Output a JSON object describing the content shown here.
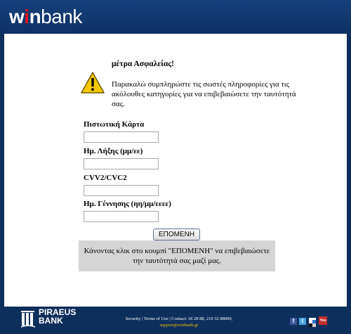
{
  "header": {
    "logo_w": "w",
    "logo_i": "i",
    "logo_n": "n",
    "logo_bank": "bank"
  },
  "notice": {
    "title": "μέτρα Ασφαλείας!",
    "intro": "Παρακαλώ συμπληρώστε τις σωστές πληροφορίες για τις ακόλουθες κατηγορίες για να επιβεβαιώσετε την ταυτότητά σας."
  },
  "form": {
    "fields": [
      {
        "label": "Πιστωτική Κάρτα",
        "value": ""
      },
      {
        "label": "Ημ. Λήξης (μμ/εε)",
        "value": ""
      },
      {
        "label": "CVV2/CVC2",
        "value": ""
      },
      {
        "label": "Ημ. Γέννησης (ηη/μμ/εεεε)",
        "value": ""
      }
    ],
    "next_label": "ΕΠΟΜΕΝΗ"
  },
  "note": "Κάνοντας κλικ στο κουμπί \"ΕΠΟΜΕΝΗ\" να επιβεβαιώσετε την ταυτότητά σας μαζί μας.",
  "footer": {
    "bank_line1": "PIRAEUS",
    "bank_line2": "BANK",
    "security": "Security",
    "terms": "Terms of Use",
    "contact": "Contact: 18 28 88, 210 32 88000,",
    "email": "support@winbank.gr",
    "separator": " | ",
    "social": [
      "f",
      "t",
      "",
      "You"
    ]
  },
  "colors": {
    "page_background": "#0d2f5c",
    "logo_accent": "#e8141b",
    "email_link": "#f2c200"
  }
}
